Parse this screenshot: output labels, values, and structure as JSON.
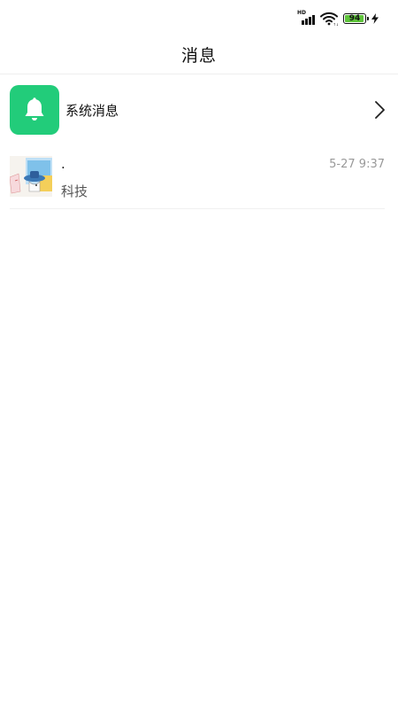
{
  "status_bar": {
    "network_badge": "HD",
    "battery_level": "94",
    "battery_fraction": 0.94,
    "icons": [
      "signal-icon",
      "wifi-icon",
      "battery-icon",
      "charging-icon"
    ]
  },
  "header": {
    "title": "消息"
  },
  "system_messages": {
    "label": "系统消息",
    "icon": "bell-icon",
    "icon_bg_color": "#22cc7a",
    "chevron": "chevron-right-icon"
  },
  "conversations": [
    {
      "name": ".",
      "time": "5-27 9:37",
      "preview": "科技",
      "avatar": "cartoon-avatar-image"
    }
  ],
  "colors": {
    "accent_green": "#22cc7a",
    "battery_green": "#5ec33a",
    "secondary_text": "#999999"
  }
}
